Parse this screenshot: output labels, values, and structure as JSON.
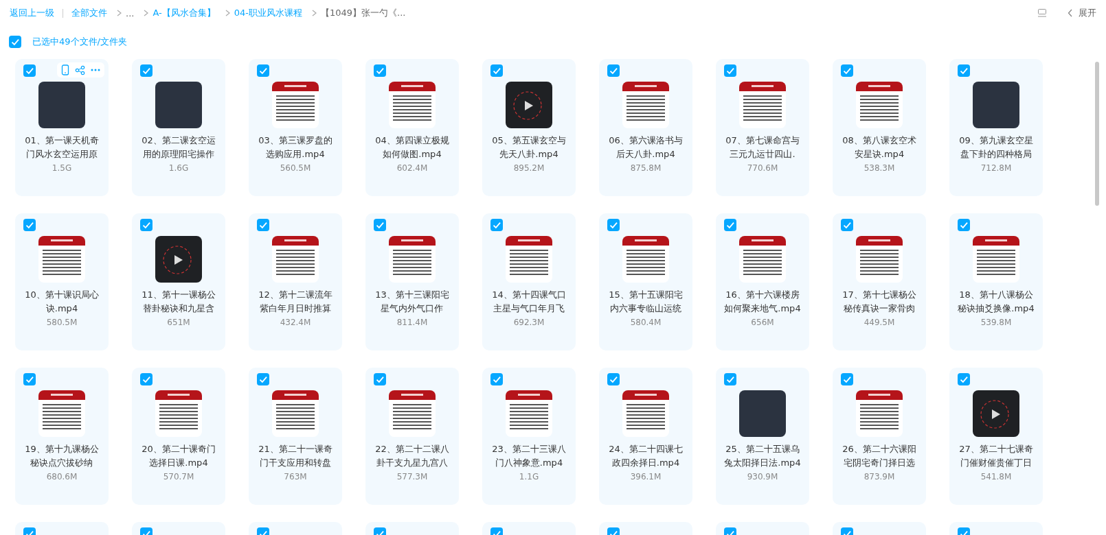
{
  "breadcrumb": {
    "back": "返回上一级",
    "items": [
      {
        "label": "全部文件",
        "kind": "link"
      },
      {
        "label": "...",
        "kind": "ellipsis"
      },
      {
        "label": "A-【风水合集】",
        "kind": "link"
      },
      {
        "label": "04-职业风水课程",
        "kind": "link"
      },
      {
        "label": "【1049】张一勺《...",
        "kind": "current"
      }
    ]
  },
  "toolbar": {
    "expand": "展开"
  },
  "selection": {
    "checked": true,
    "label": "已选中49个文件/文件夹"
  },
  "files": [
    {
      "lines": [
        "01、第一课天机奇",
        "门风水玄空运用原"
      ],
      "size": "1.5G",
      "kind": "photo",
      "checked": true,
      "hover": true
    },
    {
      "lines": [
        "02、第二课玄空运",
        "用的原理阳宅操作"
      ],
      "size": "1.6G",
      "kind": "photo",
      "checked": true,
      "hover": false
    },
    {
      "lines": [
        "03、第三课罗盘的",
        "选购应用.mp4"
      ],
      "size": "560.5M",
      "kind": "slide",
      "checked": true,
      "hover": false
    },
    {
      "lines": [
        "04、第四课立极规",
        "如何做图.mp4"
      ],
      "size": "602.4M",
      "kind": "slide",
      "checked": true,
      "hover": false
    },
    {
      "lines": [
        "05、第五课玄空与",
        "先天八卦.mp4"
      ],
      "size": "895.2M",
      "kind": "player",
      "checked": true,
      "hover": false
    },
    {
      "lines": [
        "06、第六课洛书与",
        "后天八卦.mp4"
      ],
      "size": "875.8M",
      "kind": "slide",
      "checked": true,
      "hover": false
    },
    {
      "lines": [
        "07、第七课命宫与",
        "三元九运廿四山."
      ],
      "size": "770.6M",
      "kind": "slide",
      "checked": true,
      "hover": false
    },
    {
      "lines": [
        "08、第八课玄空术",
        "安星诀.mp4"
      ],
      "size": "538.3M",
      "kind": "slide",
      "checked": true,
      "hover": false
    },
    {
      "lines": [
        "09、第九课玄空星",
        "盘下卦的四种格局"
      ],
      "size": "712.8M",
      "kind": "photo",
      "checked": true,
      "hover": false
    },
    {
      "lines": [
        "10、第十课识局心",
        "诀.mp4"
      ],
      "size": "580.5M",
      "kind": "slide",
      "checked": true,
      "hover": false
    },
    {
      "lines": [
        "11、第十一课杨公",
        "替卦秘诀和九星含"
      ],
      "size": "651M",
      "kind": "player",
      "checked": true,
      "hover": false
    },
    {
      "lines": [
        "12、第十二课流年",
        "紫白年月日时推算"
      ],
      "size": "432.4M",
      "kind": "slide",
      "checked": true,
      "hover": false
    },
    {
      "lines": [
        "13、第十三课阳宅",
        "星气内外气口作"
      ],
      "size": "811.4M",
      "kind": "slide",
      "checked": true,
      "hover": false
    },
    {
      "lines": [
        "14、第十四课气口",
        "主星与气口年月飞"
      ],
      "size": "692.3M",
      "kind": "slide",
      "checked": true,
      "hover": false
    },
    {
      "lines": [
        "15、第十五课阳宅",
        "内六事专临山运统"
      ],
      "size": "580.4M",
      "kind": "slide",
      "checked": true,
      "hover": false
    },
    {
      "lines": [
        "16、第十六课楼房",
        "如何聚来地气.mp4"
      ],
      "size": "656M",
      "kind": "slide",
      "checked": true,
      "hover": false
    },
    {
      "lines": [
        "17、第十七课杨公",
        "秘传真诀一家骨肉"
      ],
      "size": "449.5M",
      "kind": "slide",
      "checked": true,
      "hover": false
    },
    {
      "lines": [
        "18、第十八课杨公",
        "秘诀抽爻换像.mp4"
      ],
      "size": "539.8M",
      "kind": "slide",
      "checked": true,
      "hover": false
    },
    {
      "lines": [
        "19、第十九课杨公",
        "秘诀点穴拔砂纳"
      ],
      "size": "680.6M",
      "kind": "slide",
      "checked": true,
      "hover": false
    },
    {
      "lines": [
        "20、第二十课奇门",
        "选择日课.mp4"
      ],
      "size": "570.7M",
      "kind": "slide",
      "checked": true,
      "hover": false
    },
    {
      "lines": [
        "21、第二十一课奇",
        "门干支应用和转盘"
      ],
      "size": "763M",
      "kind": "slide",
      "checked": true,
      "hover": false
    },
    {
      "lines": [
        "22、第二十二课八",
        "卦干支九星九宫八"
      ],
      "size": "577.3M",
      "kind": "slide",
      "checked": true,
      "hover": false
    },
    {
      "lines": [
        "23、第二十三课八",
        "门八神象意.mp4"
      ],
      "size": "1.1G",
      "kind": "slide",
      "checked": true,
      "hover": false
    },
    {
      "lines": [
        "24、第二十四课七",
        "政四余择日.mp4"
      ],
      "size": "396.1M",
      "kind": "slide",
      "checked": true,
      "hover": false
    },
    {
      "lines": [
        "25、第二十五课乌",
        "兔太阳择日法.mp4"
      ],
      "size": "930.9M",
      "kind": "photo",
      "checked": true,
      "hover": false
    },
    {
      "lines": [
        "26、第二十六课阳",
        "宅阴宅奇门择日选"
      ],
      "size": "873.9M",
      "kind": "slide",
      "checked": true,
      "hover": false
    },
    {
      "lines": [
        "27、第二十七课奇",
        "门催财催贵催丁日"
      ],
      "size": "541.8M",
      "kind": "player",
      "checked": true,
      "hover": false
    },
    {
      "checked": true,
      "hover": false
    },
    {
      "checked": true,
      "hover": false
    },
    {
      "checked": true,
      "hover": false
    },
    {
      "checked": true,
      "hover": false
    },
    {
      "checked": true,
      "hover": false
    },
    {
      "checked": true,
      "hover": false
    },
    {
      "checked": true,
      "hover": false
    },
    {
      "checked": true,
      "hover": false
    },
    {
      "checked": true,
      "hover": false
    }
  ]
}
